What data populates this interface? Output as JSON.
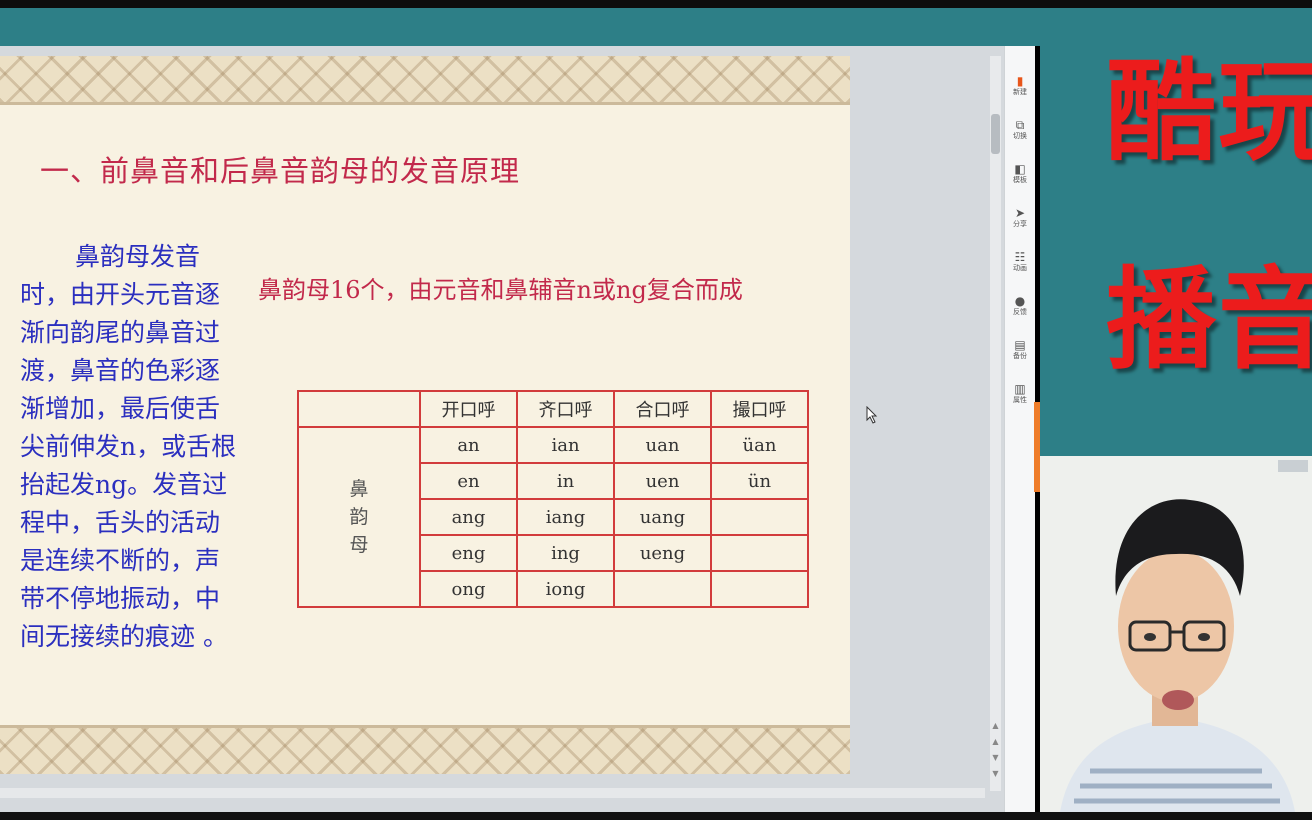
{
  "slide": {
    "title": "一、前鼻音和后鼻音韵母的发音原理",
    "left_text": "鼻韵母发音时，由开头元音逐渐向韵尾的鼻音过渡，鼻音的色彩逐渐增加，最后使舌尖前伸发n，或舌根抬起发ng。发音过程中，舌头的活动是连续不断的，声带不停地振动，中间无接续的痕迹 。",
    "subtitle": "鼻韵母16个，由元音和鼻辅音n或ng复合而成",
    "table": {
      "headers": [
        "开口呼",
        "齐口呼",
        "合口呼",
        "撮口呼"
      ],
      "row_label": "鼻韵母",
      "rows": [
        [
          "an",
          "ian",
          "uan",
          "üan"
        ],
        [
          "en",
          "in",
          "uen",
          "ün"
        ],
        [
          "ang",
          "iang",
          "uang",
          ""
        ],
        [
          "eng",
          "ing",
          "ueng",
          ""
        ],
        [
          "ong",
          "iong",
          "",
          ""
        ]
      ]
    }
  },
  "toolbar": {
    "items": [
      {
        "label": "新建",
        "icon": "new-file-icon"
      },
      {
        "label": "切换",
        "icon": "switch-icon"
      },
      {
        "label": "模板",
        "icon": "template-icon"
      },
      {
        "label": "分享",
        "icon": "share-icon"
      },
      {
        "label": "动画",
        "icon": "animation-icon"
      },
      {
        "label": "反馈",
        "icon": "feedback-icon"
      },
      {
        "label": "备份",
        "icon": "backup-icon"
      },
      {
        "label": "属性",
        "icon": "properties-icon"
      }
    ]
  },
  "promo": {
    "line1": "酷玩",
    "line2": "播音"
  },
  "colors": {
    "title_red": "#c2294b",
    "body_blue": "#2b2fbf",
    "table_border": "#d23c3c",
    "promo_bg": "#2d7f87",
    "promo_text": "#ec1c1c"
  }
}
